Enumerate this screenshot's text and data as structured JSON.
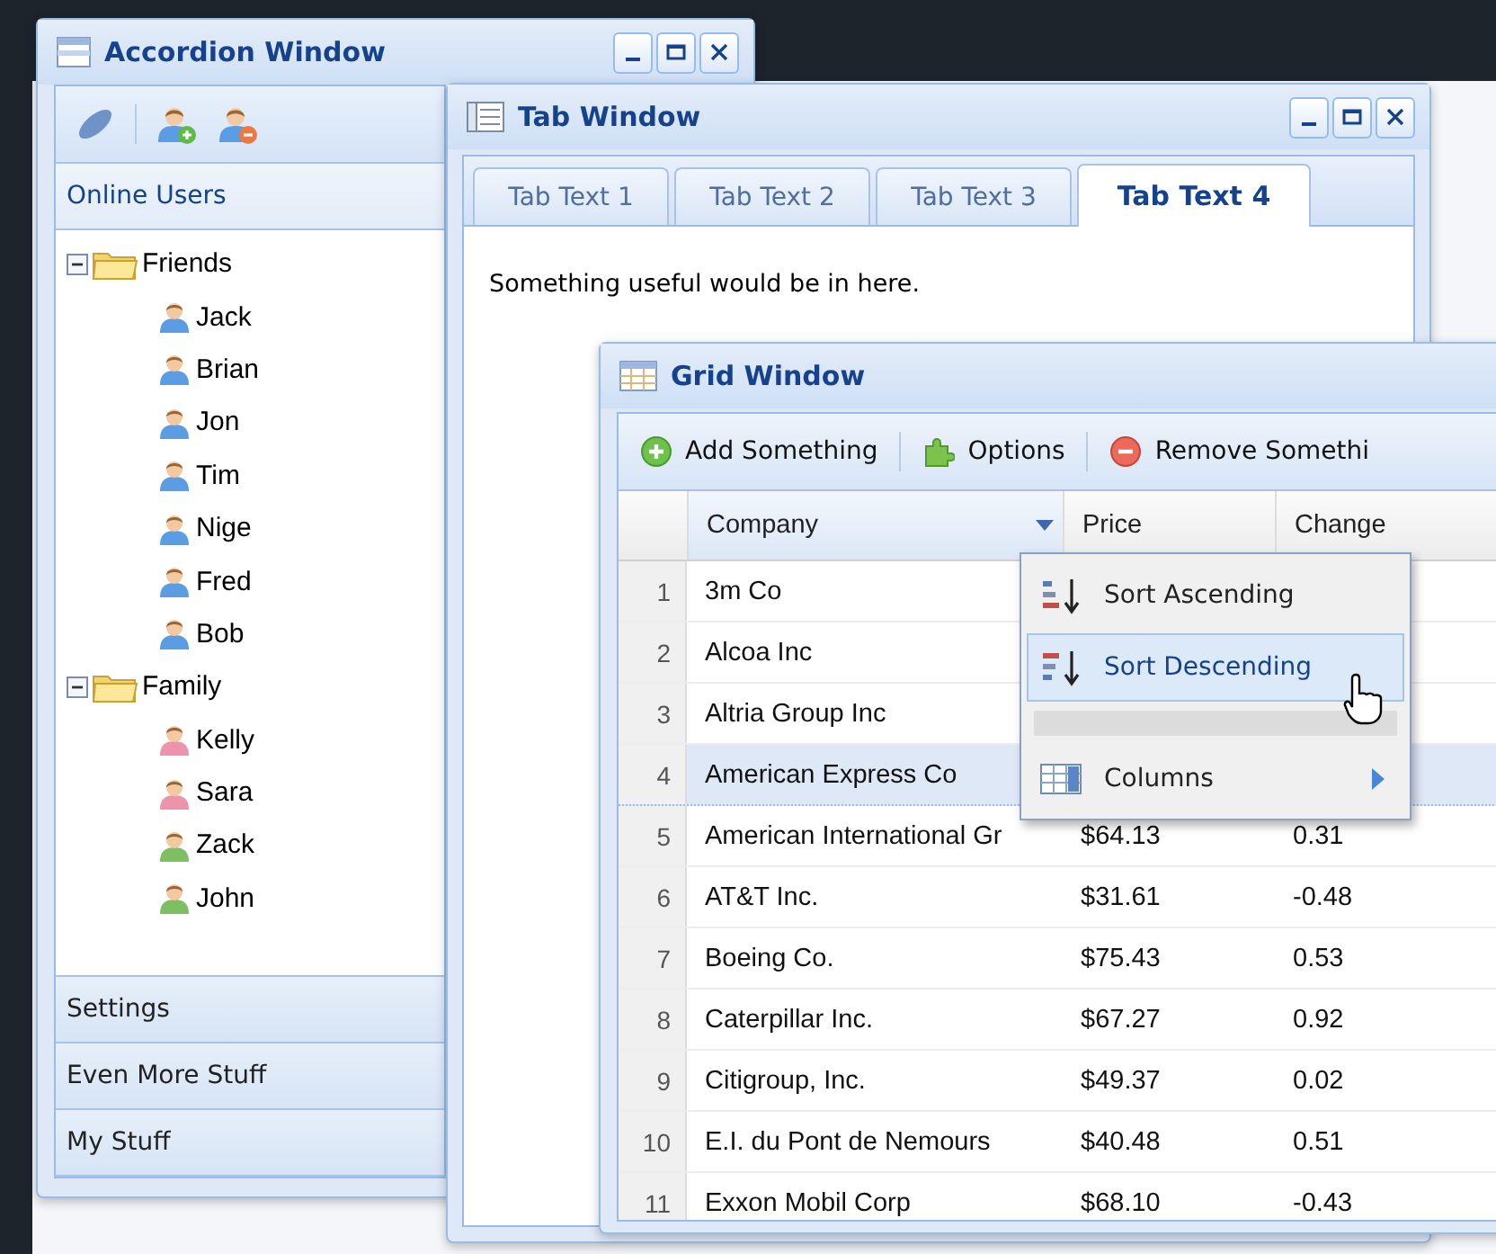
{
  "accordion_window": {
    "title": "Accordion Window",
    "sections": [
      {
        "title": "Online Users",
        "expanded": true,
        "tree": [
          {
            "label": "Friends",
            "expanded": true,
            "children": [
              {
                "label": "Jack",
                "color": "#5b9de3"
              },
              {
                "label": "Brian",
                "color": "#5b9de3"
              },
              {
                "label": "Jon",
                "color": "#5b9de3"
              },
              {
                "label": "Tim",
                "color": "#5b9de3"
              },
              {
                "label": "Nige",
                "color": "#5b9de3"
              },
              {
                "label": "Fred",
                "color": "#5b9de3"
              },
              {
                "label": "Bob",
                "color": "#5b9de3"
              }
            ]
          },
          {
            "label": "Family",
            "expanded": true,
            "children": [
              {
                "label": "Kelly",
                "color": "#ee93ac"
              },
              {
                "label": "Sara",
                "color": "#ee93ac"
              },
              {
                "label": "Zack",
                "color": "#7dbf62"
              },
              {
                "label": "John",
                "color": "#7dbf62"
              }
            ]
          }
        ]
      },
      {
        "title": "Settings",
        "expanded": false
      },
      {
        "title": "Even More Stuff",
        "expanded": false
      },
      {
        "title": "My Stuff",
        "expanded": false
      }
    ]
  },
  "tab_window": {
    "title": "Tab Window",
    "tabs": [
      {
        "label": "Tab Text 1",
        "selected": false
      },
      {
        "label": "Tab Text 2",
        "selected": false
      },
      {
        "label": "Tab Text 3",
        "selected": false
      },
      {
        "label": "Tab Text 4",
        "selected": true
      }
    ],
    "content": "Something useful would be in here."
  },
  "grid_window": {
    "title": "Grid Window",
    "toolbar": [
      {
        "label": "Add Something",
        "kind": "add"
      },
      {
        "label": "Options",
        "kind": "options"
      },
      {
        "label": "Remove Somethi",
        "kind": "remove"
      }
    ],
    "columns": [
      {
        "label": "Company",
        "hovered": true
      },
      {
        "label": "Price",
        "hovered": false
      },
      {
        "label": "Change",
        "hovered": false
      }
    ],
    "rows": [
      {
        "number": "1",
        "company": "3m Co",
        "selected": false
      },
      {
        "number": "2",
        "company": "Alcoa Inc",
        "selected": false
      },
      {
        "number": "3",
        "company": "Altria Group Inc",
        "selected": false
      },
      {
        "number": "4",
        "company": "American Express Co",
        "selected": true
      },
      {
        "number": "5",
        "company": "American International Gr",
        "price": "$64.13",
        "change": "0.31",
        "selected": false
      },
      {
        "number": "6",
        "company": "AT&T Inc.",
        "price": "$31.61",
        "change": "-0.48",
        "selected": false
      },
      {
        "number": "7",
        "company": "Boeing Co.",
        "price": "$75.43",
        "change": "0.53",
        "selected": false
      },
      {
        "number": "8",
        "company": "Caterpillar Inc.",
        "price": "$67.27",
        "change": "0.92",
        "selected": false
      },
      {
        "number": "9",
        "company": "Citigroup, Inc.",
        "price": "$49.37",
        "change": "0.02",
        "selected": false
      },
      {
        "number": "10",
        "company": "E.I. du Pont de Nemours",
        "price": "$40.48",
        "change": "0.51",
        "selected": false
      },
      {
        "number": "11",
        "company": "Exxon Mobil Corp",
        "price": "$68.10",
        "change": "-0.43",
        "selected": false
      }
    ],
    "column_menu": {
      "items": [
        {
          "label": "Sort Ascending",
          "kind": "sort-ascending",
          "selected": false
        },
        {
          "label": "Sort Descending",
          "kind": "sort-descending",
          "selected": true
        },
        {
          "kind": "separator"
        },
        {
          "label": "Columns",
          "kind": "columns",
          "selected": false
        }
      ]
    }
  }
}
